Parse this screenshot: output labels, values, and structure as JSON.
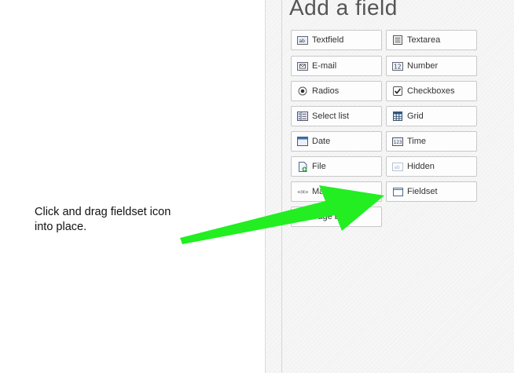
{
  "panel": {
    "title": "Add a field"
  },
  "fields": {
    "textfield": "Textfield",
    "textarea": "Textarea",
    "email": "E-mail",
    "number": "Number",
    "radios": "Radios",
    "checkboxes": "Checkboxes",
    "select_list": "Select list",
    "grid": "Grid",
    "date": "Date",
    "time": "Time",
    "file": "File",
    "hidden": "Hidden",
    "markup": "Markup",
    "fieldset": "Fieldset",
    "pagebreak": "Page break"
  },
  "annotation": {
    "caption": "Click and drag fieldset icon into place.",
    "arrow_color": "#22ee22"
  }
}
